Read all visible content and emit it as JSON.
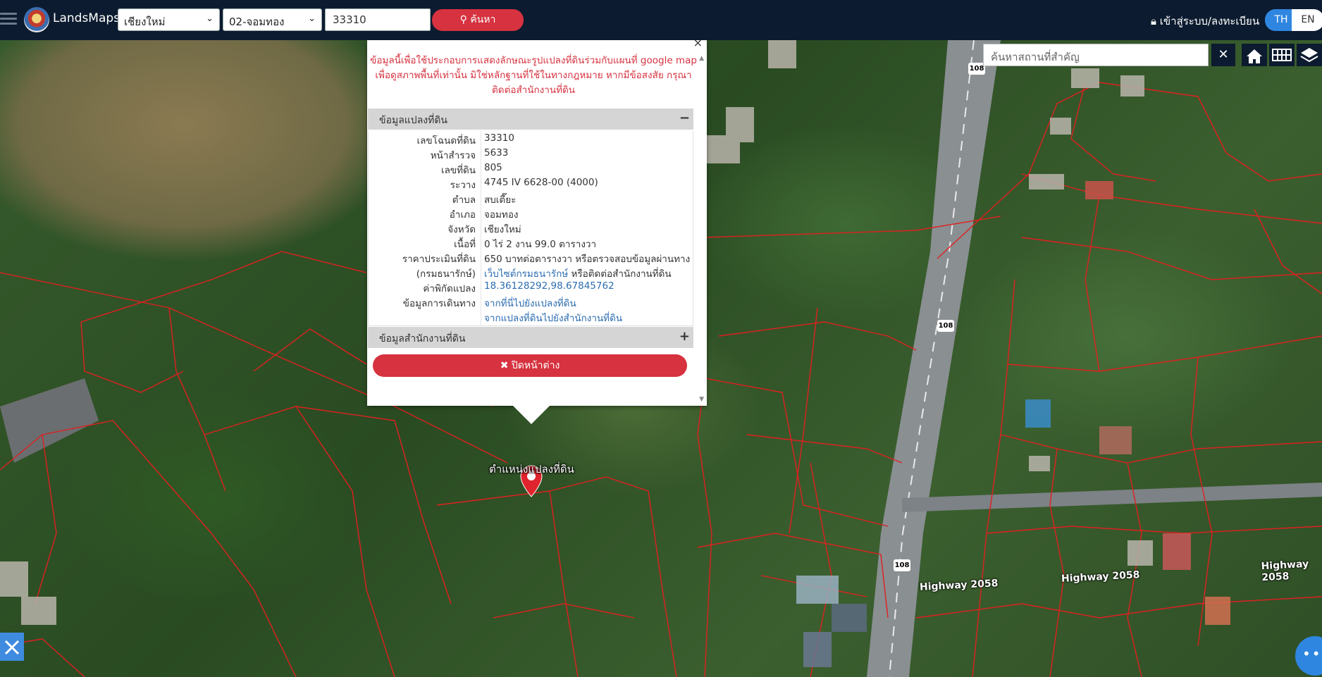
{
  "header": {
    "brand": "LandsMaps",
    "province": "เชียงใหม่",
    "district": "02-จอมทอง",
    "parcel_no": "33310",
    "search_label": "ค้นหา",
    "login_label": "เข้าสู่ระบบ/ลงทะเบียน",
    "lang_th": "TH",
    "lang_en": "EN"
  },
  "map_tools": {
    "place_search_placeholder": "ค้นหาสถานที่สำคัญ",
    "clear_icon": "close-icon",
    "home_icon": "home-icon",
    "grid_icon": "grid-icon",
    "layers_icon": "layers-icon",
    "edit_icon": "ruler-pencil-icon",
    "more_icon": "more-icon"
  },
  "map": {
    "road_shields": [
      "108",
      "108",
      "108"
    ],
    "road_labels": [
      "Highway 2058",
      "Highway 2058",
      "Highway 2058"
    ],
    "marker_label": "ตำแหน่งแปลงที่ดิน"
  },
  "popup": {
    "disclaimer_line1": "ข้อมูลนี้เพื่อใช้ประกอบการแสดงลักษณะรูปแปลงที่ดินร่วมกับแผนที่ google map",
    "disclaimer_line2": "เพื่อดูสภาพพื้นที่เท่านั้น มิใช่หลักฐานที่ใช้ในทางกฎหมาย หากมีข้อสงสัย กรุณา",
    "disclaimer_line3": "ติดต่อสำนักงานที่ดิน",
    "land_section_title": "ข้อมูลแปลงที่ดิน",
    "land_section_toggle": "−",
    "office_section_title": "ข้อมูลสำนักงานที่ดิน",
    "office_section_toggle": "+",
    "close_label": "✖ ปิดหน้าต่าง",
    "rows": [
      {
        "label": "เลขโฉนดที่ดิน",
        "value": "33310"
      },
      {
        "label": "หน้าสำรวจ",
        "value": "5633"
      },
      {
        "label": "เลขที่ดิน",
        "value": "805"
      },
      {
        "label": "ระวาง",
        "value": "4745 IV 6628-00 (4000)"
      },
      {
        "label": "ตำบล",
        "value": "สบเตี๊ยะ"
      },
      {
        "label": "อำเภอ",
        "value": "จอมทอง"
      },
      {
        "label": "จังหวัด",
        "value": "เชียงใหม่"
      },
      {
        "label": "เนื้อที่",
        "value": "0 ไร่ 2 งาน 99.0 ตารางวา"
      },
      {
        "label": "ราคาประเมินที่ดิน",
        "value": "650 บาทต่อตารางวา หรือตรวจสอบข้อมูลผ่านทาง"
      },
      {
        "label": "(กรมธนารักษ์)",
        "value_link": "เว็บไซต์กรมธนารักษ์",
        "value_rest": " หรือติดต่อสำนักงานที่ดิน"
      },
      {
        "label": "ค่าพิกัดแปลง",
        "value": "18.36128292,98.67845762"
      },
      {
        "label": "ข้อมูลการเดินทาง",
        "value": "จากที่นี่ไปยังแปลงที่ดิน"
      },
      {
        "label": "",
        "value": "จากแปลงที่ดินไปยังสำนักงานที่ดิน"
      }
    ]
  },
  "colors": {
    "topbar": "#0c1b2f",
    "accent_red": "#d6323f",
    "accent_blue": "#2f86e0",
    "parcel_line": "#e02020",
    "link": "#2b6cb0"
  }
}
